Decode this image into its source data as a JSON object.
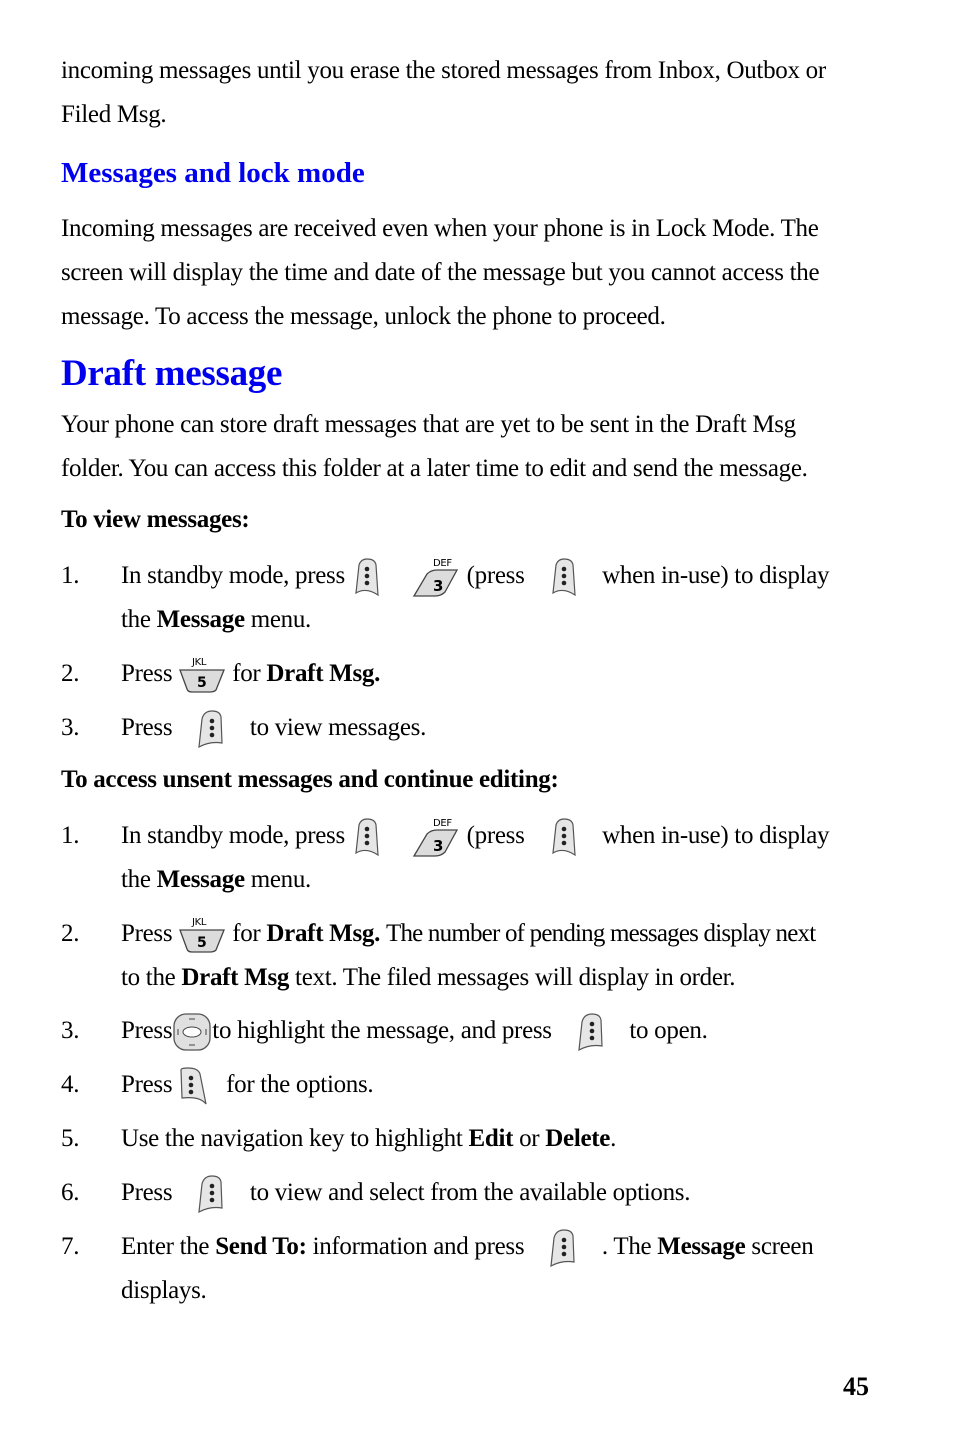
{
  "intro": {
    "line1": "incoming messages until you erase the stored messages from Inbox, Outbox or",
    "line2": "Filed Msg."
  },
  "lock_section": {
    "heading": "Messages and lock mode",
    "line1": "Incoming messages are received even when your phone is in Lock Mode. The",
    "line2": "screen will display the time and date of the message but you cannot access the",
    "line3": "message. To access the message, unlock the phone to proceed."
  },
  "draft_section": {
    "heading": "Draft message",
    "line1": "Your phone can store draft messages that are yet to be sent in the Draft Msg",
    "line2": "folder. You can access this folder at a later time to edit and send the message."
  },
  "view": {
    "heading": "To view messages:",
    "steps": [
      {
        "num": "1.",
        "a": "In standby mode, press",
        "b": "(press",
        "c": "when in-use) to display",
        "d": "the",
        "bold1": "Message",
        "e": "menu."
      },
      {
        "num": "2.",
        "a": "Press",
        "b": "for",
        "bold1": "Draft Msg."
      },
      {
        "num": "3.",
        "a": "Press",
        "b": "to view messages."
      }
    ]
  },
  "access": {
    "heading": "To access unsent messages and continue editing:",
    "steps": [
      {
        "num": "1.",
        "a": "In standby mode, press",
        "b": "(press",
        "c": "when in-use) to display",
        "d": "the",
        "bold1": "Message",
        "e": "menu."
      },
      {
        "num": "2.",
        "a": "Press",
        "b": "for",
        "bold1": "Draft Msg.",
        "c": "The number of pending messages display next",
        "d": "to the",
        "bold2": "Draft Msg",
        "e": "text. The filed messages will display in order."
      },
      {
        "num": "3.",
        "a": "Press",
        "b": "to highlight the message, and press",
        "c": "to open."
      },
      {
        "num": "4.",
        "a": "Press",
        "b": "for the options."
      },
      {
        "num": "5.",
        "a": "Use the navigation key to highlight",
        "bold1": "Edit",
        "b": "or",
        "bold2": "Delete",
        "c": "."
      },
      {
        "num": "6.",
        "a": "Press",
        "b": "to view and select from the available options."
      },
      {
        "num": "7.",
        "a": "Enter the",
        "bold1": "Send To:",
        "b": "information and press",
        "c": ". The",
        "bold2": "Message",
        "d": "screen",
        "e": "displays."
      }
    ]
  },
  "keys": {
    "k3_letters": "DEF",
    "k3_digit": "3",
    "k5_letters": "JKL",
    "k5_digit": "5"
  },
  "footer": {
    "page_number": "45"
  }
}
